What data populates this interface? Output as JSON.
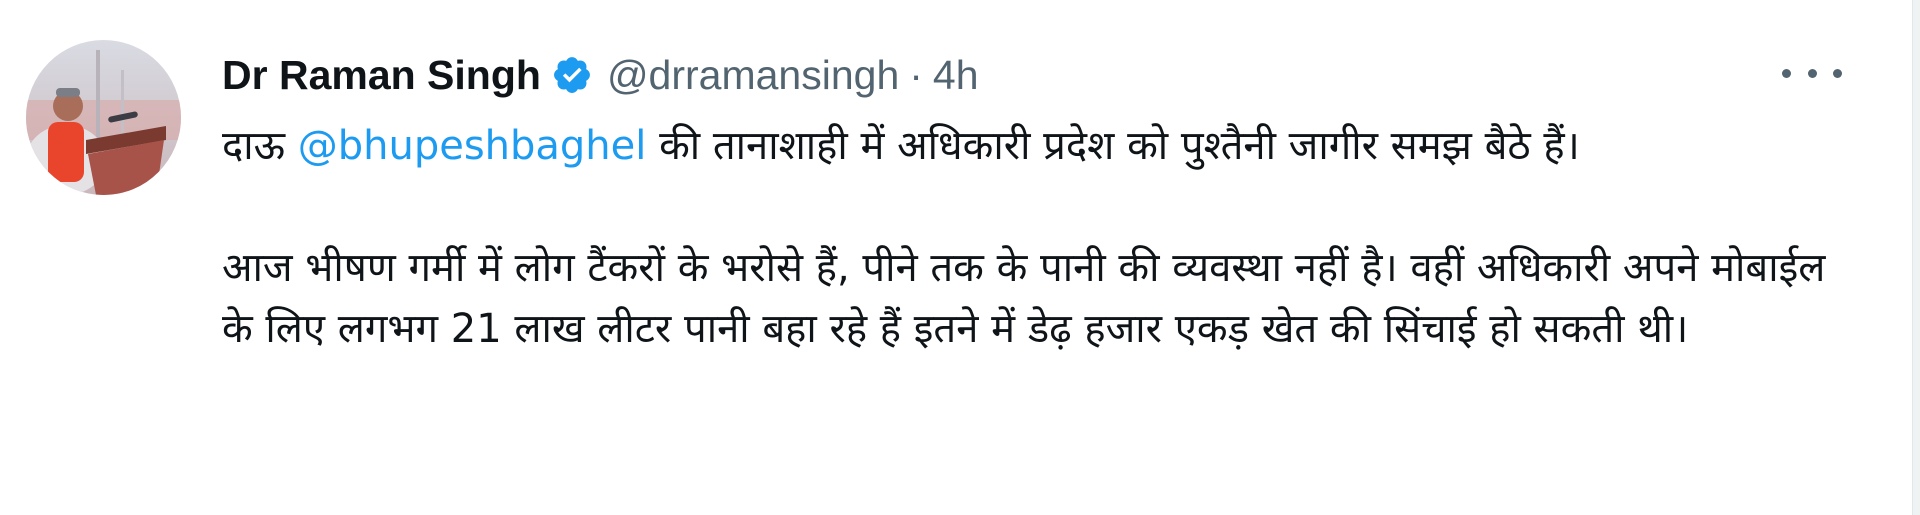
{
  "author": {
    "name": "Dr Raman Singh",
    "handle": "@drramansingh",
    "separator": "·",
    "time": "4h",
    "verified": true
  },
  "tweet": {
    "p1_prefix": "दाऊ ",
    "p1_mention": "@bhupeshbaghel",
    "p1_suffix": " की तानाशाही में अधिकारी प्रदेश को पुश्तैनी जागीर समझ बैठे हैं।",
    "p2": "आज भीषण गर्मी में लोग टैंकरों के भरोसे हैं, पीने तक के पानी की व्यवस्था नहीं है। वहीं अधिकारी अपने मोबाईल के लिए लगभग 21 लाख लीटर पानी बहा रहे हैं इतने में डेढ़ हजार एकड़ खेत की सिंचाई हो सकती थी।"
  },
  "colors": {
    "text": "#0f1419",
    "secondary": "#536471",
    "link": "#1d9bf0",
    "verified": "#1d9bf0"
  },
  "icons": {
    "verified": "verified-badge-icon",
    "more": "more-options-icon"
  }
}
